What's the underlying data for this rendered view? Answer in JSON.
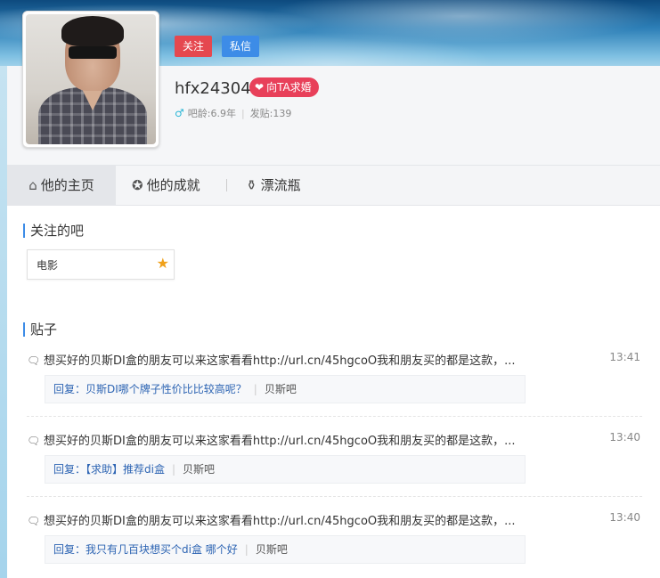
{
  "profile": {
    "username": "hfx24304",
    "follow_label": "关注",
    "message_label": "私信",
    "propose_label": "向TA求婚",
    "gender_icon": "male-icon",
    "bar_age": "吧龄:6.9年",
    "post_count": "发贴:139"
  },
  "tabs": [
    {
      "label": "他的主页",
      "icon": "home-icon",
      "active": true
    },
    {
      "label": "他的成就",
      "icon": "medal-icon",
      "active": false
    },
    {
      "label": "漂流瓶",
      "icon": "bottle-icon",
      "active": false
    }
  ],
  "followed_bars": {
    "title": "关注的吧",
    "items": [
      {
        "name": "电影",
        "icon": "star-icon"
      }
    ]
  },
  "posts": {
    "title": "贴子",
    "items": [
      {
        "title": "想买好的贝斯DI盒的朋友可以来这家看看http://url.cn/45hgcoO我和朋友买的都是这款，...",
        "time": "13:41",
        "reply": "回复：贝斯DI哪个牌子性价比比较高呢？",
        "forum": "贝斯吧"
      },
      {
        "title": "想买好的贝斯DI盒的朋友可以来这家看看http://url.cn/45hgcoO我和朋友买的都是这款，...",
        "time": "13:40",
        "reply": "回复：【求助】推荐di盒",
        "forum": "贝斯吧"
      },
      {
        "title": "想买好的贝斯DI盒的朋友可以来这家看看http://url.cn/45hgcoO我和朋友买的都是这款，...",
        "time": "13:40",
        "reply": "回复：我只有几百块想买个di盒 哪个好",
        "forum": "贝斯吧"
      }
    ]
  },
  "colors": {
    "follow": "#e5484f",
    "message": "#3d8ce7",
    "propose": "#e8405a",
    "link": "#2d64b3",
    "accent": "#3d8ce7"
  }
}
